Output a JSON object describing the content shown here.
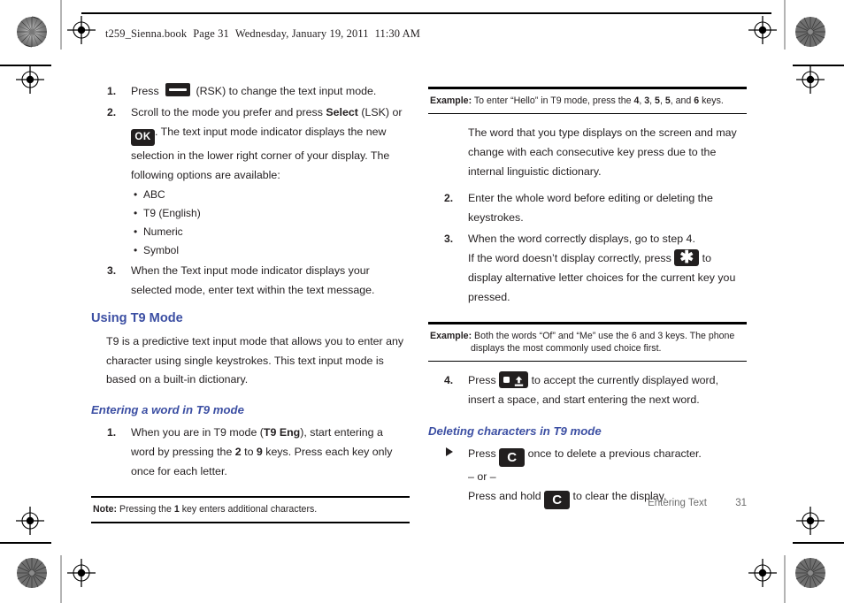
{
  "header": {
    "book": "t259_Sienna.book",
    "page_label": "Page 31",
    "date": "Wednesday, January 19, 2011",
    "time": "11:30 AM"
  },
  "left_column": {
    "steps": [
      {
        "num": "1.",
        "pre": "Press",
        "key": "rsk-dash-key",
        "post": "(RSK) to change the text input mode."
      },
      {
        "num": "2.",
        "line1_a": "Scroll to the mode you prefer and press ",
        "line1_bold": "Select",
        "line1_b": " (LSK) or",
        "key": "ok-key",
        "line2": ". The text input mode indicator displays the new selection in the lower right corner of your display. The following options are available:"
      },
      {
        "num": "3.",
        "text": "When the Text input mode indicator displays your selected mode, enter text within the text message."
      }
    ],
    "options": [
      "ABC",
      "T9 (English)",
      "Numeric",
      "Symbol"
    ],
    "heading": "Using T9 Mode",
    "paragraph": "T9 is a predictive text input mode that allows you to enter any character using single keystrokes. This text input mode is based on a built-in dictionary.",
    "subheading": "Entering a word in T9 mode",
    "step1": {
      "num": "1.",
      "a": "When you are in T9 mode (",
      "bold1": "T9 Eng",
      "b": "), start entering a word by pressing the ",
      "bold2": "2",
      "c": " to ",
      "bold3": "9",
      "d": " keys. Press each key only once for each letter."
    },
    "note": {
      "label": "Note:",
      "a": " Pressing the ",
      "bold": "1",
      "b": " key enters additional characters."
    }
  },
  "right_column": {
    "example1": {
      "label": "Example:",
      "a": " To enter “Hello” in T9 mode, press the ",
      "k1": "4",
      "s1": ", ",
      "k2": "3",
      "s2": ", ",
      "k3": "5",
      "s3": ", ",
      "k4": "5",
      "s4": ", and ",
      "k5": "6",
      "b": " keys."
    },
    "intro": "The word that you type displays on the screen and may change with each consecutive key press due to the internal linguistic dictionary.",
    "steps": [
      {
        "num": "2.",
        "text": "Enter the whole word before editing or deleting the keystrokes."
      },
      {
        "num": "3.",
        "text": "When the word correctly displays, go to step 4.",
        "sub_a": "If the word doesn’t display correctly, press ",
        "key": "asterisk-key",
        "sub_b": " to display alternative letter choices for the current key you pressed."
      }
    ],
    "example2": {
      "label": "Example:",
      "a": " Both the words “Of” and “Me” use the 6 and 3 keys. The phone",
      "b": "displays the most commonly used choice first."
    },
    "step4": {
      "num": "4.",
      "a": "Press ",
      "key": "space-shift-key",
      "b": " to accept the currently displayed word, insert a space, and start entering the next word."
    },
    "subheading": "Deleting characters in T9 mode",
    "delete": {
      "a": "Press ",
      "key1": "clear-key",
      "b": " once to delete a previous character.",
      "or": "– or –",
      "c": "Press and hold ",
      "key2": "clear-key",
      "d": " to clear the display."
    }
  },
  "footer": {
    "section": "Entering Text",
    "page_number": "31"
  },
  "colors": {
    "heading_blue": "#3c4fa3",
    "text_black": "#231f20",
    "footer_gray": "#6e6e6e",
    "key_black": "#221f1f"
  }
}
